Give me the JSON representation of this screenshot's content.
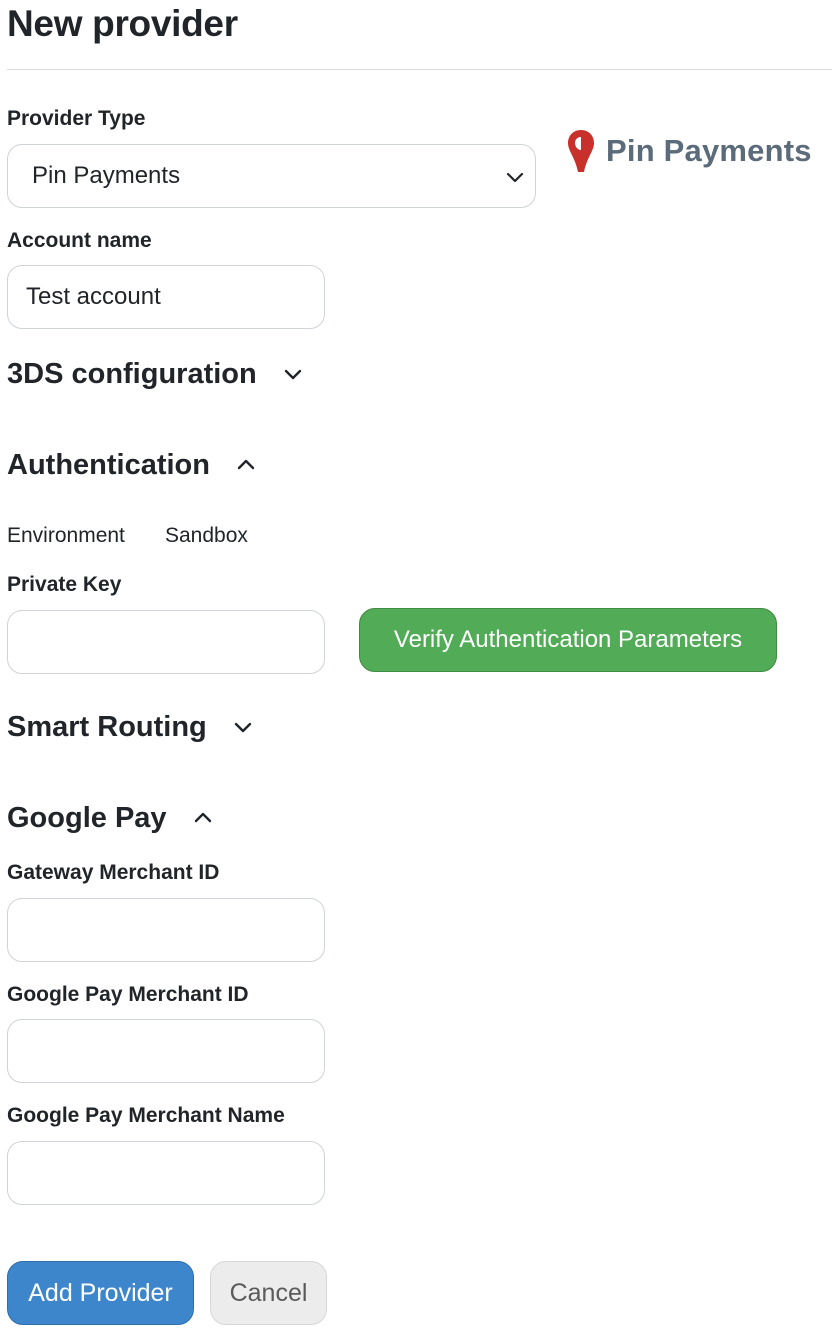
{
  "page": {
    "title": "New provider"
  },
  "provider_type": {
    "label": "Provider Type",
    "selected": "Pin Payments",
    "icon": "chevron-down-icon"
  },
  "brand": {
    "name": "Pin Payments",
    "pin_color": "#c8302c",
    "text_color": "#5b6b7a"
  },
  "account_name": {
    "label": "Account name",
    "value": "Test account"
  },
  "sections": {
    "three_ds": {
      "title": "3DS configuration",
      "state": "collapsed",
      "icon": "chevron-down-icon"
    },
    "authentication": {
      "title": "Authentication",
      "state": "expanded",
      "icon": "chevron-up-icon",
      "environment_label": "Environment",
      "environment_value": "Sandbox",
      "private_key_label": "Private Key",
      "private_key_value": "",
      "verify_button": "Verify Authentication Parameters"
    },
    "smart_routing": {
      "title": "Smart Routing",
      "state": "collapsed",
      "icon": "chevron-down-icon"
    },
    "google_pay": {
      "title": "Google Pay",
      "state": "expanded",
      "icon": "chevron-up-icon",
      "gateway_merchant_id_label": "Gateway Merchant ID",
      "gateway_merchant_id_value": "",
      "google_pay_merchant_id_label": "Google Pay Merchant ID",
      "google_pay_merchant_id_value": "",
      "google_pay_merchant_name_label": "Google Pay Merchant Name",
      "google_pay_merchant_name_value": ""
    }
  },
  "actions": {
    "add_label": "Add Provider",
    "cancel_label": "Cancel"
  },
  "colors": {
    "primary": "#3e86cb",
    "success": "#52ab57",
    "secondary": "#ececec"
  }
}
